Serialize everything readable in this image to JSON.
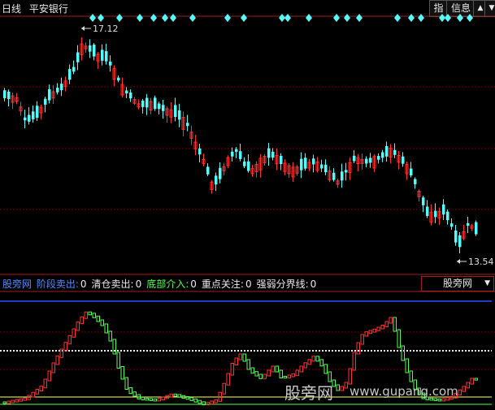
{
  "header": {
    "period": "日线",
    "stock_name": "平安银行"
  },
  "toolbar": {
    "index_label": "指",
    "info_label": "信息",
    "up_arrow": "▲",
    "down_arrow": "▼"
  },
  "price_chart": {
    "high_label": "17.12",
    "low_label": "13.54",
    "high_value": 17.12,
    "low_value": 13.54,
    "colors": {
      "up": "#ff3232",
      "down": "#54fcfc",
      "grid": "#7a0000",
      "marker": "#54fcfc"
    }
  },
  "indicator": {
    "name": "股旁网",
    "items": [
      {
        "label": "阶段卖出:",
        "value": "0",
        "color": "#4f8cff"
      },
      {
        "label": "清仓卖出:",
        "value": "0",
        "color": "#e8e8e8"
      },
      {
        "label": "底部介入:",
        "value": "0",
        "color": "#50ff50"
      },
      {
        "label": "重点关注:",
        "value": "0",
        "color": "#e8e8e8"
      },
      {
        "label": "强弱分界线:",
        "value": "0",
        "color": "#e8e8e8"
      }
    ],
    "selector_value": "股旁网",
    "selector_arrow": "▼",
    "colors": {
      "up": "#ff3232",
      "down": "#50ff50",
      "blue_line": "#3050ff",
      "yellow_line": "#ffff80",
      "dotted": "#ffffff"
    }
  },
  "watermark": {
    "cn": "股旁网",
    "url": "www.gupang.com"
  }
}
